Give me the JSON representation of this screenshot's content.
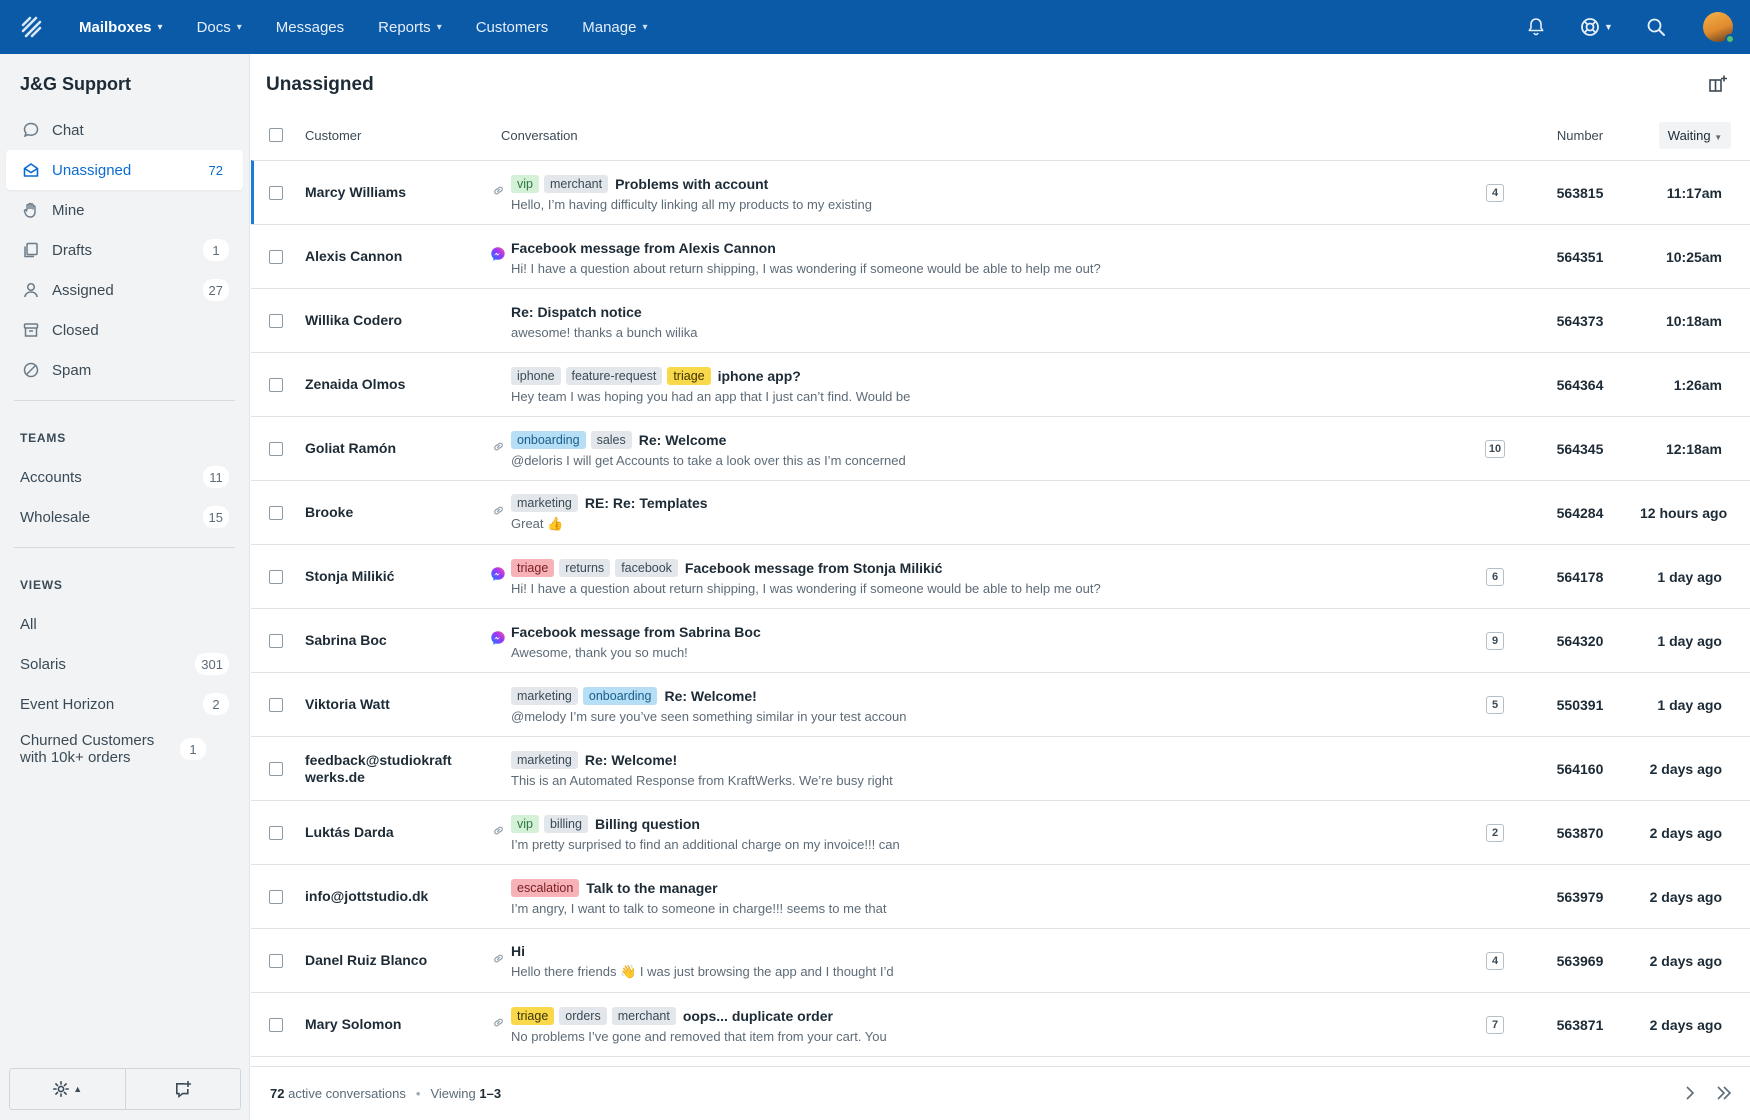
{
  "nav": {
    "items": [
      {
        "label": "Mailboxes",
        "dropdown": true,
        "active": true
      },
      {
        "label": "Docs",
        "dropdown": true
      },
      {
        "label": "Messages",
        "dropdown": false
      },
      {
        "label": "Reports",
        "dropdown": true
      },
      {
        "label": "Customers",
        "dropdown": false
      },
      {
        "label": "Manage",
        "dropdown": true
      }
    ],
    "right_icons": [
      "bell-icon",
      "help-icon",
      "search-icon",
      "avatar"
    ]
  },
  "sidebar": {
    "mailbox_name": "J&G Support",
    "folders": [
      {
        "label": "Chat",
        "count": "",
        "icon": "chat-icon"
      },
      {
        "label": "Unassigned",
        "count": "72",
        "icon": "inbox-icon",
        "active": true
      },
      {
        "label": "Mine",
        "count": "",
        "icon": "hand-icon"
      },
      {
        "label": "Drafts",
        "count": "1",
        "icon": "drafts-icon"
      },
      {
        "label": "Assigned",
        "count": "27",
        "icon": "person-icon"
      },
      {
        "label": "Closed",
        "count": "",
        "icon": "archive-icon"
      },
      {
        "label": "Spam",
        "count": "",
        "icon": "spam-icon"
      }
    ],
    "teams_heading": "TEAMS",
    "teams": [
      {
        "label": "Accounts",
        "count": "11"
      },
      {
        "label": "Wholesale",
        "count": "15"
      }
    ],
    "views_heading": "VIEWS",
    "views": [
      {
        "label": "All",
        "count": ""
      },
      {
        "label": "Solaris",
        "count": "301"
      },
      {
        "label": "Event Horizon",
        "count": "2"
      },
      {
        "label": "Churned Customers with 10k+ orders",
        "count": "1"
      }
    ]
  },
  "main": {
    "title": "Unassigned",
    "columns": {
      "customer": "Customer",
      "conversation": "Conversation",
      "number": "Number",
      "waiting": "Waiting"
    },
    "rows": [
      {
        "customer": "Marcy Williams",
        "indicator": "link",
        "tags": [
          {
            "t": "vip",
            "c": "vip"
          },
          {
            "t": "merchant",
            "c": ""
          }
        ],
        "subject": "Problems with account",
        "preview": "Hello, I’m having difficulty linking all my products to my existing",
        "threads": "4",
        "number": "563815",
        "waiting": "11:17am"
      },
      {
        "customer": "Alexis Cannon",
        "indicator": "messenger",
        "tags": [],
        "subject": "Facebook message from Alexis Cannon",
        "preview": "Hi! I have a question about return shipping, I was wondering if someone would be able to help me out?",
        "threads": "",
        "number": "564351",
        "waiting": "10:25am"
      },
      {
        "customer": "Willika Codero",
        "indicator": "",
        "tags": [],
        "subject": "Re: Dispatch notice",
        "preview": "awesome! thanks a bunch wilika",
        "threads": "",
        "number": "564373",
        "waiting": "10:18am"
      },
      {
        "customer": "Zenaida Olmos",
        "indicator": "",
        "tags": [
          {
            "t": "iphone",
            "c": ""
          },
          {
            "t": "feature-request",
            "c": ""
          },
          {
            "t": "triage",
            "c": "triage"
          }
        ],
        "subject": "iphone app?",
        "preview": "Hey team I was hoping you had an app that I just can’t find. Would be",
        "threads": "",
        "number": "564364",
        "waiting": "1:26am"
      },
      {
        "customer": "Goliat Ramón",
        "indicator": "link",
        "tags": [
          {
            "t": "onboarding",
            "c": "onboarding"
          },
          {
            "t": "sales",
            "c": ""
          }
        ],
        "subject": "Re: Welcome",
        "preview": "@deloris I will get Accounts to take a look over this as I’m concerned",
        "threads": "10",
        "number": "564345",
        "waiting": "12:18am"
      },
      {
        "customer": "Brooke",
        "indicator": "link",
        "tags": [
          {
            "t": "marketing",
            "c": ""
          }
        ],
        "subject": "RE: Re: Templates",
        "preview": "Great 👍",
        "threads": "",
        "number": "564284",
        "waiting": "12 hours ago"
      },
      {
        "customer": "Stonja Milikić",
        "indicator": "messenger",
        "tags": [
          {
            "t": "triage",
            "c": "triage-red"
          },
          {
            "t": "returns",
            "c": ""
          },
          {
            "t": "facebook",
            "c": ""
          }
        ],
        "subject": "Facebook message from Stonja Milikić",
        "preview": "Hi! I have a question about return shipping, I was wondering if someone would be able to help me out?",
        "threads": "6",
        "number": "564178",
        "waiting": "1 day ago"
      },
      {
        "customer": "Sabrina Boc",
        "indicator": "messenger",
        "tags": [],
        "subject": "Facebook message from Sabrina Boc",
        "preview": "Awesome, thank you so much!",
        "threads": "9",
        "number": "564320",
        "waiting": "1 day ago"
      },
      {
        "customer": "Viktoria Watt",
        "indicator": "",
        "tags": [
          {
            "t": "marketing",
            "c": ""
          },
          {
            "t": "onboarding",
            "c": "onboarding"
          }
        ],
        "subject": "Re: Welcome!",
        "preview": "@melody I’m sure you’ve seen something similar in your test accoun",
        "threads": "5",
        "number": "550391",
        "waiting": "1 day ago"
      },
      {
        "customer": "feedback@studiokraft werks.de",
        "indicator": "",
        "tags": [
          {
            "t": "marketing",
            "c": ""
          }
        ],
        "subject": "Re: Welcome!",
        "preview": "This is an Automated Response from KraftWerks. We’re busy right",
        "threads": "",
        "number": "564160",
        "waiting": "2 days ago"
      },
      {
        "customer": "Luktás Darda",
        "indicator": "link",
        "tags": [
          {
            "t": "vip",
            "c": "vip"
          },
          {
            "t": "billing",
            "c": ""
          }
        ],
        "subject": "Billing question",
        "preview": "I’m pretty surprised to find an additional charge on my invoice!!! can",
        "threads": "2",
        "number": "563870",
        "waiting": "2 days ago"
      },
      {
        "customer": "info@jottstudio.dk",
        "indicator": "",
        "tags": [
          {
            "t": "escalation",
            "c": "escalation"
          }
        ],
        "subject": "Talk to the manager",
        "preview": "I’m angry, I want to talk to someone in charge!!! seems to me that",
        "threads": "",
        "number": "563979",
        "waiting": "2 days ago"
      },
      {
        "customer": "Danel Ruiz Blanco",
        "indicator": "link",
        "tags": [],
        "subject": "Hi",
        "preview": "Hello there friends 👋 I was just browsing the app and I thought I’d",
        "threads": "4",
        "number": "563969",
        "waiting": "2 days ago"
      },
      {
        "customer": "Mary Solomon",
        "indicator": "link",
        "tags": [
          {
            "t": "triage",
            "c": "triage"
          },
          {
            "t": "orders",
            "c": ""
          },
          {
            "t": "merchant",
            "c": ""
          }
        ],
        "subject": "oops... duplicate order",
        "preview": "No problems I’ve gone and removed that item from your cart. You",
        "threads": "7",
        "number": "563871",
        "waiting": "2 days ago"
      }
    ]
  },
  "footer": {
    "count": "72",
    "count_suffix": "active conversations",
    "viewing_label": "Viewing",
    "viewing_range": "1–3"
  },
  "colors": {
    "topbar": "#0a5aa8",
    "accent": "#0a6cd1",
    "sidebar_bg": "#f1f3f5"
  }
}
